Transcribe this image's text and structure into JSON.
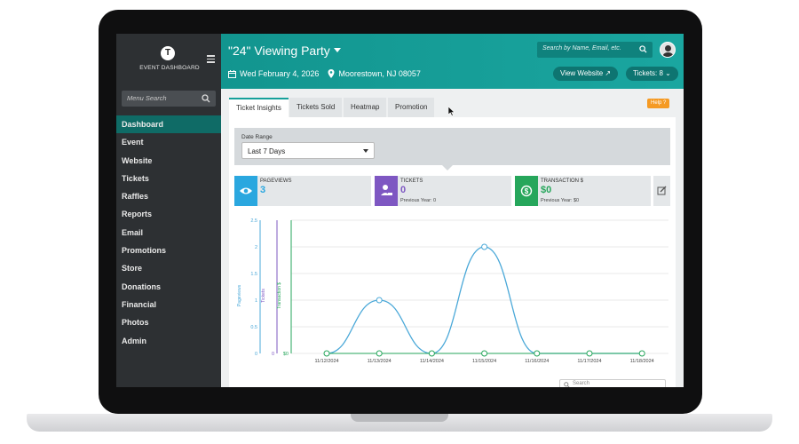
{
  "sidebar": {
    "logo_letter": "T",
    "title": "EVENT DASHBOARD",
    "search_placeholder": "Menu Search",
    "items": [
      {
        "label": "Dashboard",
        "active": true
      },
      {
        "label": "Event"
      },
      {
        "label": "Website"
      },
      {
        "label": "Tickets"
      },
      {
        "label": "Raffles"
      },
      {
        "label": "Reports"
      },
      {
        "label": "Email"
      },
      {
        "label": "Promotions"
      },
      {
        "label": "Store"
      },
      {
        "label": "Donations"
      },
      {
        "label": "Financial"
      },
      {
        "label": "Photos"
      },
      {
        "label": "Admin"
      }
    ]
  },
  "header": {
    "event_title": "\"24\" Viewing Party",
    "date": "Wed February 4, 2026",
    "location": "Moorestown, NJ 08057",
    "search_placeholder": "Search by Name, Email, etc.",
    "view_website": "View Website",
    "tickets_button": "Tickets: 8"
  },
  "tabs": [
    {
      "label": "Ticket Insights",
      "active": true
    },
    {
      "label": "Tickets Sold"
    },
    {
      "label": "Heatmap"
    },
    {
      "label": "Promotion"
    }
  ],
  "help_label": "Help",
  "date_range": {
    "label": "Date Range",
    "selected": "Last 7 Days"
  },
  "stats": [
    {
      "label": "PAGEVIEWS",
      "value": "3",
      "previous": "",
      "color": "#2aa7df",
      "icon": "eye-icon"
    },
    {
      "label": "TICKETS",
      "value": "0",
      "previous": "Previous Year: 0",
      "color": "#7e57c2",
      "icon": "user-ticket-icon"
    },
    {
      "label": "TRANSACTION $",
      "value": "$0",
      "previous": "Previous Year: $0",
      "color": "#26a65b",
      "icon": "dollar-icon"
    }
  ],
  "bottom_search_placeholder": "Search",
  "chart_data": {
    "type": "line",
    "categories": [
      "11/12/2024",
      "11/13/2024",
      "11/14/2024",
      "11/15/2024",
      "11/16/2024",
      "11/17/2024",
      "11/18/2024"
    ],
    "series": [
      {
        "name": "Pageviews",
        "values": [
          0,
          1,
          0,
          2,
          0,
          0,
          0
        ],
        "color": "#4aa8d8"
      },
      {
        "name": "Tickets",
        "values": [
          0,
          0,
          0,
          0,
          0,
          0,
          0
        ],
        "color": "#7e57c2"
      },
      {
        "name": "Transaction $",
        "values": [
          0,
          0,
          0,
          0,
          0,
          0,
          0
        ],
        "color": "#26a65b"
      }
    ],
    "axes": [
      {
        "label": "Pageviews",
        "ticks": [
          "0",
          "0.5",
          "1",
          "1.5",
          "2",
          "2.5"
        ],
        "range": [
          0,
          2.5
        ]
      },
      {
        "label": "Tickets",
        "ticks": [
          "0"
        ]
      },
      {
        "label": "Transaction $",
        "ticks": [
          "$0"
        ]
      }
    ],
    "grid": true
  }
}
